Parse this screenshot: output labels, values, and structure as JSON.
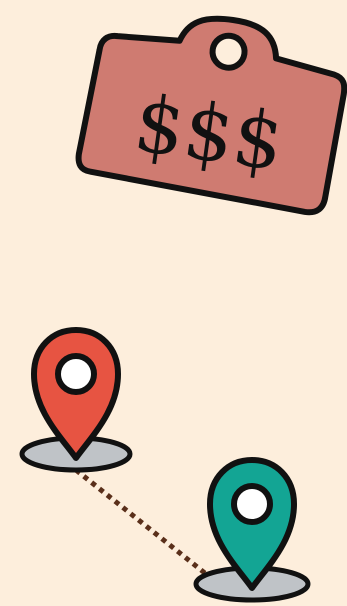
{
  "colors": {
    "background": "#fdeedc",
    "price_tag": "#cf7b71",
    "pin_start": "#e75442",
    "pin_end": "#13a594",
    "pin_base": "#bfc3c7",
    "route": "#5a2f1a",
    "outline": "#111111"
  },
  "price_tag": {
    "label": "$$$"
  },
  "icons": {
    "tag": "price-tag-icon",
    "pin_start": "location-pin-icon",
    "pin_end": "location-pin-icon"
  }
}
